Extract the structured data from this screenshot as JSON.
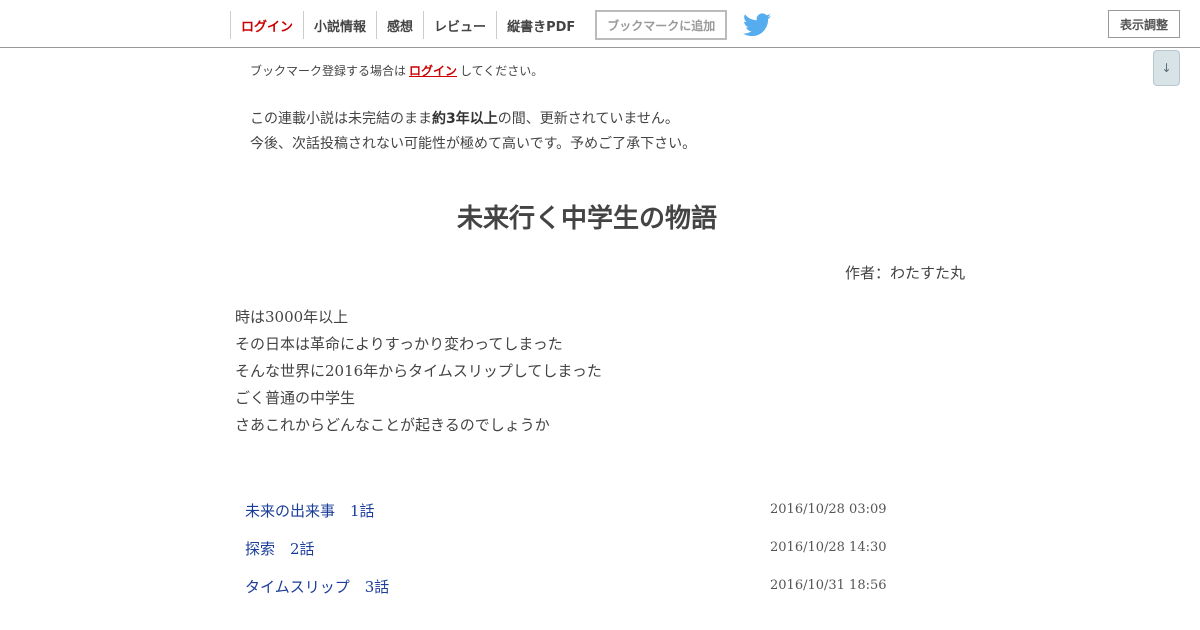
{
  "header": {
    "nav": {
      "login": "ログイン",
      "novel_info": "小説情報",
      "impressions": "感想",
      "review": "レビュー",
      "vertical_pdf": "縦書きPDF"
    },
    "bookmark_button": "ブックマークに追加",
    "display_settings": "表示調整",
    "scroll_down": "↓"
  },
  "login_note": {
    "prefix": "ブックマーク登録する場合は",
    "link": "ログイン",
    "suffix": "してください。"
  },
  "warning": {
    "line1_prefix": "この連載小説は未完結のまま",
    "line1_bold": "約3年以上",
    "line1_suffix": "の間、更新されていません。",
    "line2": "今後、次話投稿されない可能性が極めて高いです。予めご了承下さい。"
  },
  "novel": {
    "title": "未来行く中学生の物語",
    "author": "作者：わたすた丸"
  },
  "synopsis": [
    "時は3000年以上",
    "その日本は革命によりすっかり変わってしまった",
    "そんな世界に2016年からタイムスリップしてしまった",
    "ごく普通の中学生",
    "さあこれからどんなことが起きるのでしょうか"
  ],
  "chapters": [
    {
      "title": "未来の出来事　1話",
      "date": "2016/10/28 03:09"
    },
    {
      "title": "探索　2話",
      "date": "2016/10/28 14:30"
    },
    {
      "title": "タイムスリップ　3話",
      "date": "2016/10/31 18:56"
    }
  ],
  "colors": {
    "accent_red": "#cc0000",
    "link_blue": "#1a3d99",
    "twitter_blue": "#55acee"
  }
}
